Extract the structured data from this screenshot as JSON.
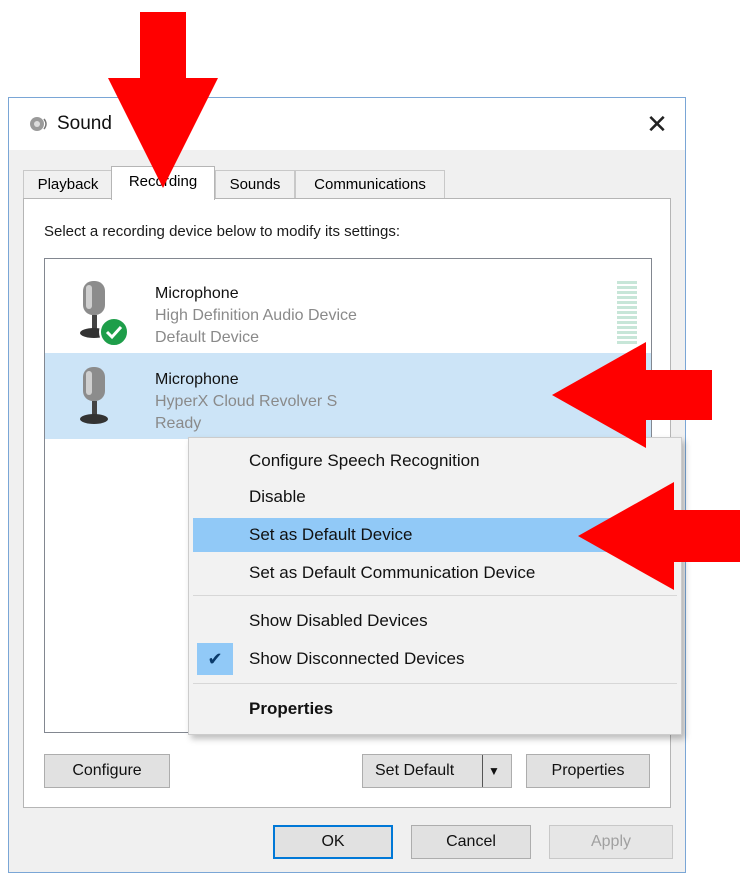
{
  "window": {
    "title": "Sound",
    "close_glyph": "✕"
  },
  "tabs": [
    {
      "label": "Playback",
      "active": false
    },
    {
      "label": "Recording",
      "active": true
    },
    {
      "label": "Sounds",
      "active": false
    },
    {
      "label": "Communications",
      "active": false
    }
  ],
  "instruction": "Select a recording device below to modify its settings:",
  "devices": [
    {
      "name": "Microphone",
      "detail": "High Definition Audio Device",
      "status": "Default Device",
      "default_check": true,
      "selected": false,
      "icon": "microphone-icon"
    },
    {
      "name": "Microphone",
      "detail": "HyperX Cloud Revolver S",
      "status": "Ready",
      "default_check": false,
      "selected": true,
      "icon": "microphone-icon"
    }
  ],
  "panel_buttons": {
    "configure": "Configure",
    "set_default": "Set Default",
    "properties": "Properties"
  },
  "dialog_buttons": {
    "ok": "OK",
    "cancel": "Cancel",
    "apply": "Apply"
  },
  "context_menu": {
    "items": [
      {
        "label": "Configure Speech Recognition"
      },
      {
        "label": "Disable"
      },
      {
        "label": "Set as Default Device",
        "highlighted": true
      },
      {
        "label": "Set as Default Communication Device"
      },
      {
        "label": "Show Disabled Devices"
      },
      {
        "label": "Show Disconnected Devices",
        "checked": true,
        "check_glyph": "✔"
      },
      {
        "label": "Properties",
        "bold": true
      }
    ]
  },
  "colors": {
    "selection": "#cce4f7",
    "menu_highlight": "#91c9f7",
    "annotation_arrow": "#ff0000",
    "default_check": "#1e9e4a"
  }
}
